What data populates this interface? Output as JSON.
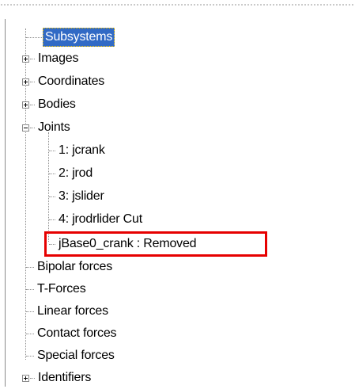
{
  "tree": {
    "root": {
      "label": "Subsystems",
      "selected": true
    },
    "items": [
      {
        "label": "Images",
        "expander": "+"
      },
      {
        "label": "Coordinates",
        "expander": "+"
      },
      {
        "label": "Bodies",
        "expander": "+"
      },
      {
        "label": "Joints",
        "expander": "-",
        "children": [
          {
            "label": "1: jcrank"
          },
          {
            "label": "2: jrod"
          },
          {
            "label": "3: jslider"
          },
          {
            "label": "4: jrodrlider Cut"
          },
          {
            "label": "jBase0_crank : Removed",
            "highlighted": true
          }
        ]
      },
      {
        "label": "Bipolar forces"
      },
      {
        "label": "T-Forces"
      },
      {
        "label": "Linear forces"
      },
      {
        "label": "Contact forces"
      },
      {
        "label": "Special forces"
      },
      {
        "label": "Identifiers",
        "expander": "+"
      }
    ]
  },
  "colors": {
    "selection": "#316ac5",
    "highlight_box": "#e60000",
    "tree_lines": "#8c8c8c"
  }
}
